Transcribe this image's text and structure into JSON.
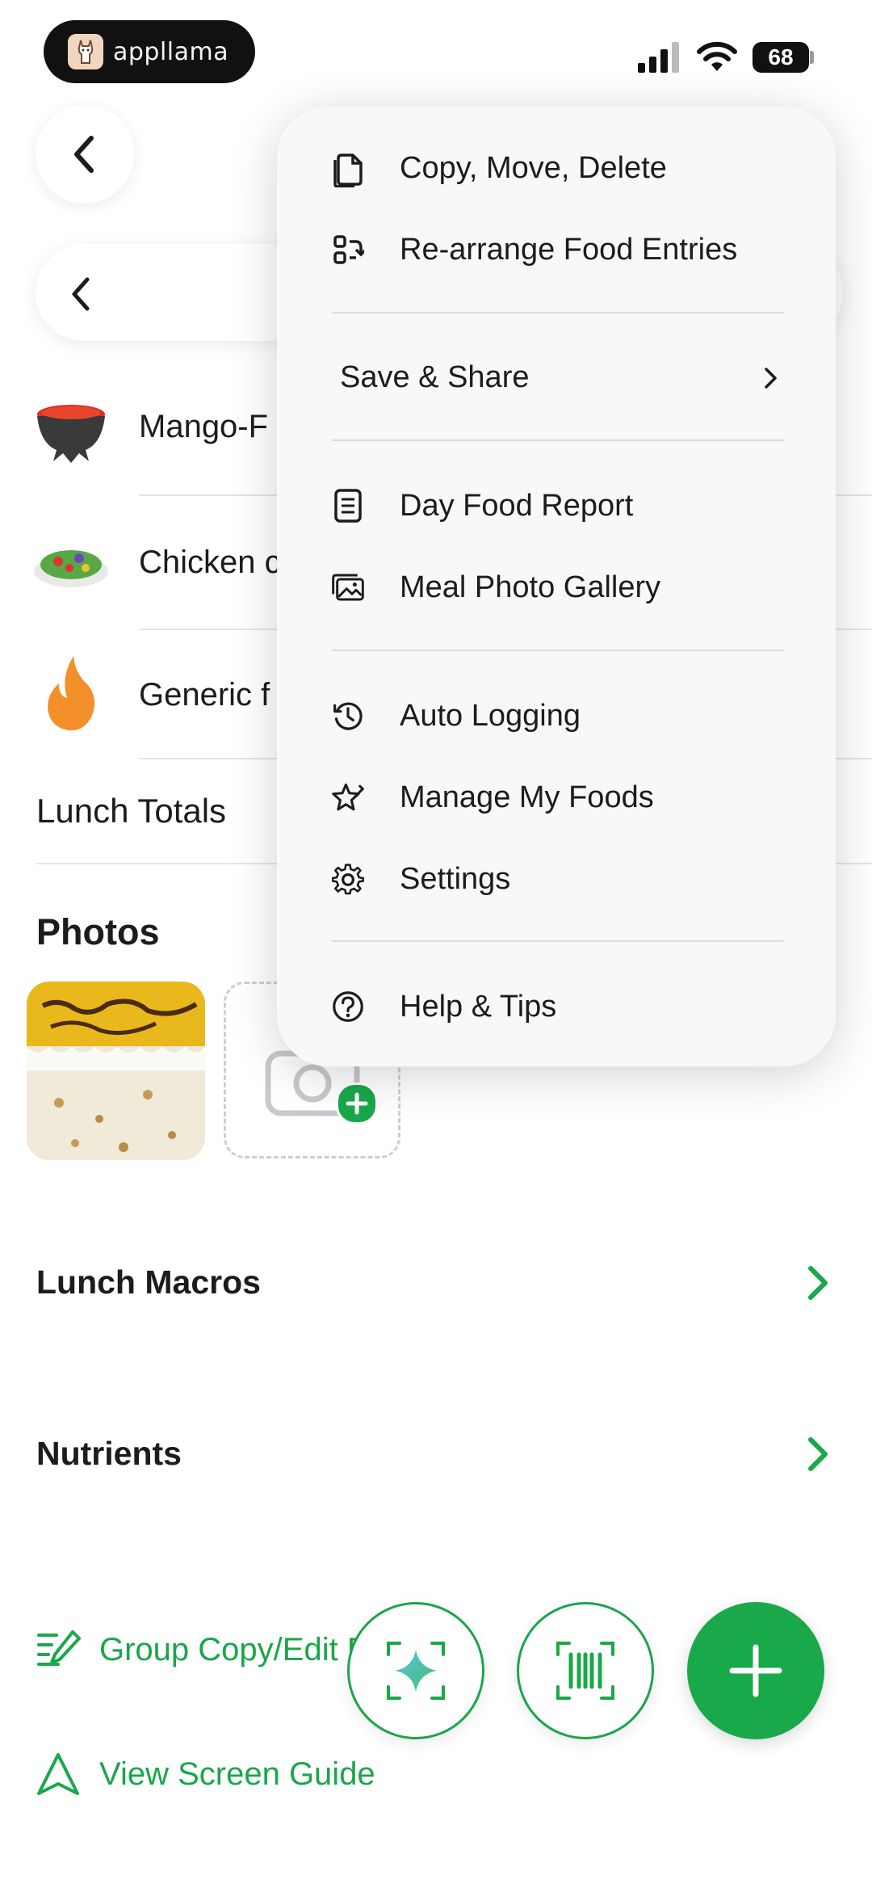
{
  "status_bar": {
    "brand": "appllama",
    "battery": "68"
  },
  "date_nav": {},
  "foods": [
    {
      "name": "Mango-F",
      "icon": "salsa-bowl-icon"
    },
    {
      "name": "Chicken c",
      "icon": "salad-icon"
    },
    {
      "name": "Generic f",
      "icon": "flame-icon"
    }
  ],
  "totals": {
    "label": "Lunch Totals"
  },
  "photos": {
    "title": "Photos"
  },
  "macros": {
    "label": "Lunch Macros"
  },
  "nutrients": {
    "label": "Nutrients"
  },
  "links": {
    "group_copy": "Group Copy/Edit Entries",
    "screen_guide": "View Screen Guide"
  },
  "menu": {
    "items": [
      {
        "label": "Copy, Move, Delete",
        "icon": "copy-files-icon"
      },
      {
        "label": "Re-arrange Food Entries",
        "icon": "rearrange-icon"
      },
      {
        "label": "Save & Share",
        "icon": "chevron-right-icon"
      },
      {
        "label": "Day Food Report",
        "icon": "report-icon"
      },
      {
        "label": "Meal Photo Gallery",
        "icon": "photo-gallery-icon"
      },
      {
        "label": "Auto Logging",
        "icon": "history-icon"
      },
      {
        "label": "Manage My Foods",
        "icon": "star-edit-icon"
      },
      {
        "label": "Settings",
        "icon": "gear-icon"
      },
      {
        "label": "Help & Tips",
        "icon": "question-icon"
      }
    ]
  },
  "colors": {
    "accent": "#19a84a",
    "text": "#1c1c1e",
    "separator": "#e4e4e8"
  }
}
